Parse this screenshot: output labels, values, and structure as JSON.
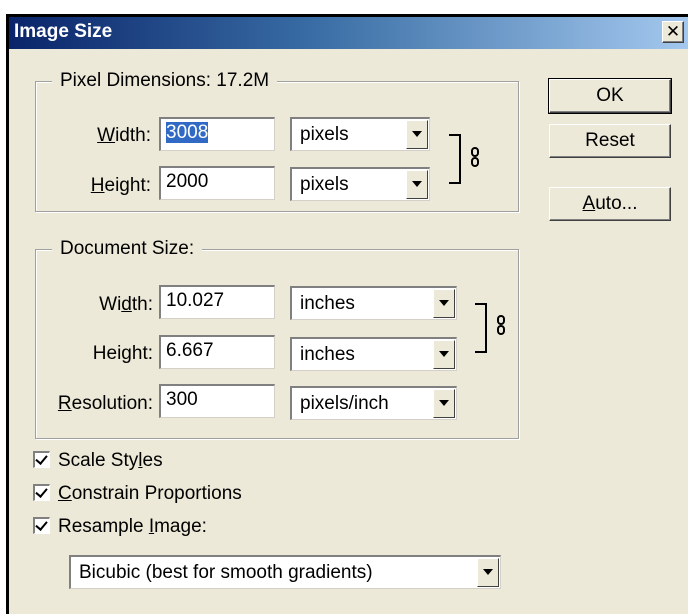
{
  "window": {
    "title": "Image Size",
    "close_symbol": "✕"
  },
  "pixel_dimensions": {
    "legend_label": "Pixel Dimensions:",
    "legend_value": "17.2M",
    "width_label_pre": "",
    "width_label_key": "W",
    "width_label_post": "idth:",
    "width_value": "3008",
    "width_unit": "pixels",
    "height_label_pre": "",
    "height_label_key": "H",
    "height_label_post": "eight:",
    "height_value": "2000",
    "height_unit": "pixels"
  },
  "document_size": {
    "legend_label": "Document Size:",
    "width_label_pre": "Wi",
    "width_label_key": "d",
    "width_label_post": "th:",
    "width_value": "10.027",
    "width_unit": "inches",
    "height_label_pre": "Hei",
    "height_label_key": "g",
    "height_label_post": "ht:",
    "height_value": "6.667",
    "height_unit": "inches",
    "resolution_label_pre": "",
    "resolution_label_key": "R",
    "resolution_label_post": "esolution:",
    "resolution_value": "300",
    "resolution_unit": "pixels/inch"
  },
  "buttons": {
    "ok": "OK",
    "reset": "Reset",
    "auto_key": "A",
    "auto_rest": "uto..."
  },
  "options": {
    "scale_styles_pre": "Scale Sty",
    "scale_styles_key": "l",
    "scale_styles_post": "es",
    "scale_styles_checked": true,
    "constrain_pre": "",
    "constrain_key": "C",
    "constrain_post": "onstrain Proportions",
    "constrain_checked": true,
    "resample_pre": "Resample ",
    "resample_key": "I",
    "resample_post": "mage:",
    "resample_checked": true,
    "resample_method": "Bicubic (best for smooth gradients)"
  },
  "icons": {
    "link": "chain-link-icon",
    "dropdown": "chevron-down-icon",
    "close": "close-icon",
    "check": "checkmark-icon"
  }
}
